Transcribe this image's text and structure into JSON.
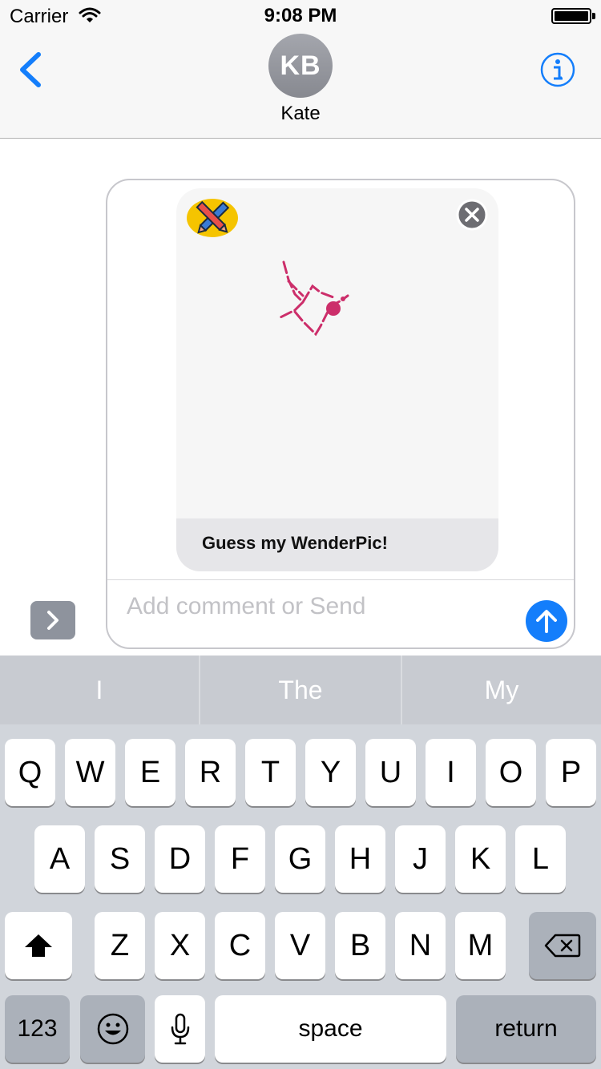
{
  "status_bar": {
    "carrier": "Carrier",
    "time": "9:08 PM"
  },
  "nav": {
    "avatar_initials": "KB",
    "contact_name": "Kate"
  },
  "message_card": {
    "caption": "Guess my WenderPic!"
  },
  "composer": {
    "placeholder": "Add comment or Send"
  },
  "predictions": [
    "I",
    "The",
    "My"
  ],
  "keyboard": {
    "row1": [
      "Q",
      "W",
      "E",
      "R",
      "T",
      "Y",
      "U",
      "I",
      "O",
      "P"
    ],
    "row2": [
      "A",
      "S",
      "D",
      "F",
      "G",
      "H",
      "J",
      "K",
      "L"
    ],
    "row3": [
      "Z",
      "X",
      "C",
      "V",
      "B",
      "N",
      "M"
    ],
    "numbers_label": "123",
    "space_label": "space",
    "return_label": "return"
  },
  "colors": {
    "accent": "#147efb",
    "drawing_ink": "#cc2e6a"
  }
}
